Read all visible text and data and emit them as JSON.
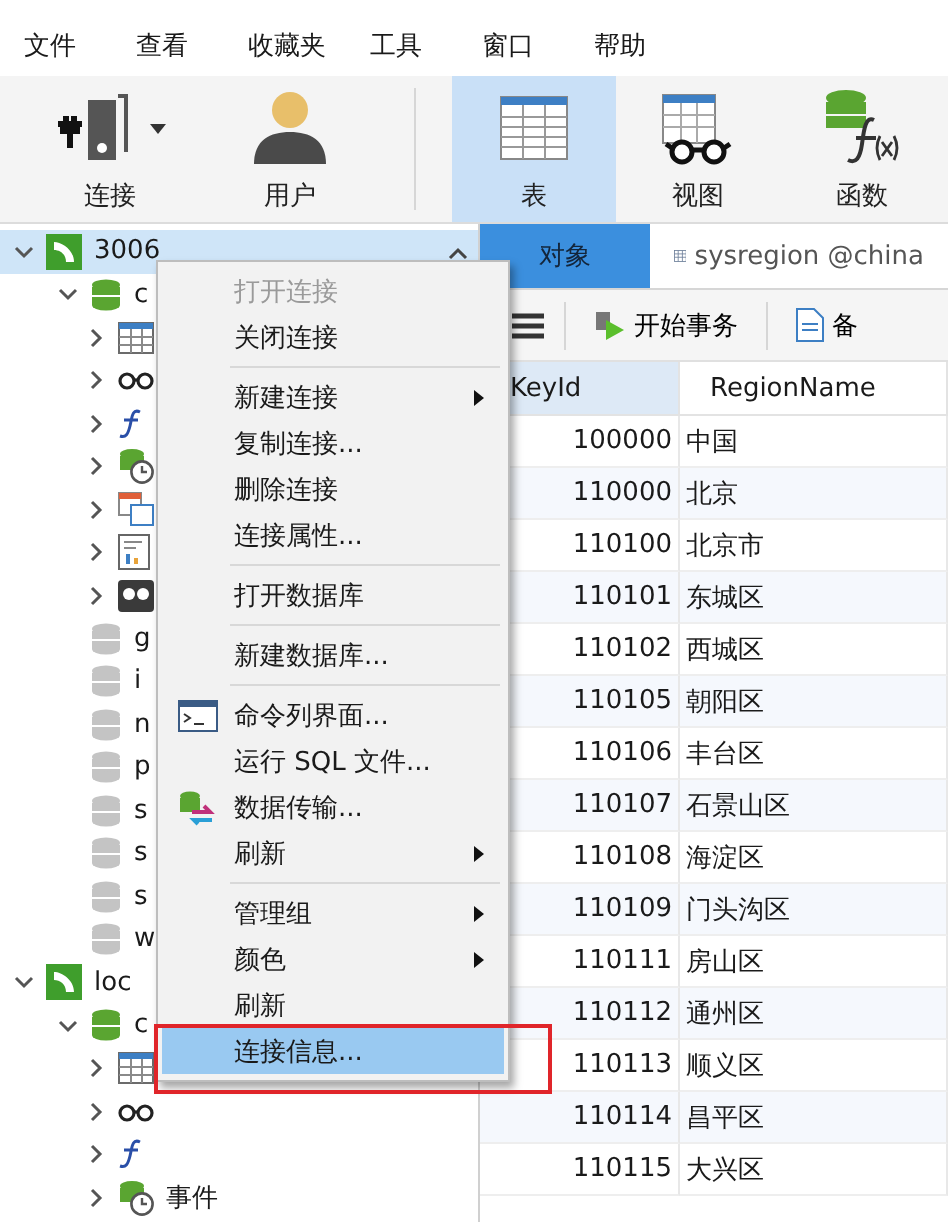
{
  "menu_bar": [
    "文件",
    "查看",
    "收藏夹",
    "工具",
    "窗口",
    "帮助"
  ],
  "toolbar": [
    {
      "label": "连接",
      "kind": "connection",
      "dropdown": true,
      "selected": false
    },
    {
      "label": "用户",
      "kind": "user",
      "dropdown": false,
      "selected": false
    },
    {
      "kind": "separator"
    },
    {
      "label": "表",
      "kind": "table",
      "dropdown": false,
      "selected": true
    },
    {
      "label": "视图",
      "kind": "view",
      "dropdown": false,
      "selected": false
    },
    {
      "label": "函数",
      "kind": "function",
      "dropdown": false,
      "selected": false
    }
  ],
  "tree": [
    {
      "label": "3006",
      "kind": "connection",
      "expanded": true,
      "selected": true,
      "children": [
        {
          "label": "c",
          "kind": "database",
          "open": true,
          "expanded": true,
          "selected": false,
          "children": [
            {
              "kind": "tables",
              "expanded": false,
              "selected": false
            },
            {
              "kind": "views",
              "expanded": false,
              "selected": false
            },
            {
              "kind": "functions",
              "expanded": false,
              "selected": false
            },
            {
              "kind": "events",
              "expanded": false,
              "selected": false
            },
            {
              "kind": "queries",
              "expanded": false,
              "selected": false
            },
            {
              "kind": "reports",
              "expanded": false,
              "selected": false
            },
            {
              "kind": "backups",
              "expanded": false,
              "selected": false
            }
          ]
        },
        {
          "label": "g",
          "kind": "database",
          "open": false,
          "selected": false
        },
        {
          "label": "i",
          "kind": "database",
          "open": false,
          "selected": false
        },
        {
          "label": "n",
          "kind": "database",
          "open": false,
          "selected": false
        },
        {
          "label": "p",
          "kind": "database",
          "open": false,
          "selected": false
        },
        {
          "label": "s",
          "kind": "database",
          "open": false,
          "selected": false
        },
        {
          "label": "s",
          "kind": "database",
          "open": false,
          "selected": false
        },
        {
          "label": "s",
          "kind": "database",
          "open": false,
          "selected": false
        },
        {
          "label": "w",
          "kind": "database",
          "open": false,
          "selected": false
        }
      ]
    },
    {
      "label": "loc",
      "kind": "connection",
      "expanded": true,
      "selected": false,
      "children": [
        {
          "label": "c",
          "kind": "database",
          "open": true,
          "expanded": true,
          "selected": false,
          "children": [
            {
              "kind": "tables",
              "expanded": false,
              "selected": false
            },
            {
              "kind": "views",
              "expanded": false,
              "selected": false
            },
            {
              "kind": "functions",
              "expanded": false,
              "selected": false
            },
            {
              "label": "事件",
              "kind": "events",
              "expanded": false,
              "selected": false
            }
          ]
        }
      ]
    }
  ],
  "tabs": [
    {
      "label": "对象",
      "kind": "objects",
      "selected": true
    },
    {
      "label": "sysregion @china",
      "kind": "table",
      "selected": false
    }
  ],
  "object_toolbar": [
    {
      "kind": "menu"
    },
    {
      "label": "开始事务",
      "kind": "transaction"
    },
    {
      "label": "备",
      "kind": "memo"
    }
  ],
  "table": {
    "columns": [
      {
        "label": "KeyId",
        "selected": true
      },
      {
        "label": "RegionName",
        "selected": false
      }
    ],
    "rows": [
      [
        "100000",
        "中国"
      ],
      [
        "110000",
        "北京"
      ],
      [
        "110100",
        "北京市"
      ],
      [
        "110101",
        "东城区"
      ],
      [
        "110102",
        "西城区"
      ],
      [
        "110105",
        "朝阳区"
      ],
      [
        "110106",
        "丰台区"
      ],
      [
        "110107",
        "石景山区"
      ],
      [
        "110108",
        "海淀区"
      ],
      [
        "110109",
        "门头沟区"
      ],
      [
        "110111",
        "房山区"
      ],
      [
        "110112",
        "通州区"
      ],
      [
        "110113",
        "顺义区"
      ],
      [
        "110114",
        "昌平区"
      ],
      [
        "110115",
        "大兴区"
      ]
    ]
  },
  "context_menu": {
    "items": [
      {
        "kind": "item",
        "label": "打开连接",
        "disabled": true,
        "submenu": false,
        "selected": false,
        "framed": false
      },
      {
        "kind": "item",
        "label": "关闭连接",
        "disabled": false,
        "submenu": false,
        "selected": false,
        "framed": false
      },
      {
        "kind": "separator"
      },
      {
        "kind": "item",
        "label": "新建连接",
        "disabled": false,
        "submenu": true,
        "selected": false,
        "framed": false
      },
      {
        "kind": "item",
        "label": "复制连接...",
        "disabled": false,
        "submenu": false,
        "selected": false,
        "framed": false
      },
      {
        "kind": "item",
        "label": "删除连接",
        "disabled": false,
        "submenu": false,
        "selected": false,
        "framed": false
      },
      {
        "kind": "item",
        "label": "连接属性...",
        "disabled": false,
        "submenu": false,
        "selected": false,
        "framed": false
      },
      {
        "kind": "separator"
      },
      {
        "kind": "item",
        "label": "打开数据库",
        "disabled": false,
        "submenu": false,
        "selected": false,
        "framed": false
      },
      {
        "kind": "separator"
      },
      {
        "kind": "item",
        "label": "新建数据库...",
        "disabled": false,
        "submenu": false,
        "selected": false,
        "framed": false
      },
      {
        "kind": "separator"
      },
      {
        "kind": "console",
        "label": "命令列界面...",
        "disabled": false,
        "submenu": false,
        "selected": false,
        "framed": false
      },
      {
        "kind": "item",
        "label": "运行 SQL 文件...",
        "disabled": false,
        "submenu": false,
        "selected": false,
        "framed": false
      },
      {
        "kind": "transfer",
        "label": "数据传输...",
        "disabled": false,
        "submenu": false,
        "selected": false,
        "framed": false
      },
      {
        "kind": "item",
        "label": "刷新",
        "disabled": false,
        "submenu": true,
        "selected": false,
        "framed": false
      },
      {
        "kind": "separator"
      },
      {
        "kind": "item",
        "label": "管理组",
        "disabled": false,
        "submenu": true,
        "selected": false,
        "framed": false
      },
      {
        "kind": "item",
        "label": "颜色",
        "disabled": false,
        "submenu": true,
        "selected": false,
        "framed": false
      },
      {
        "kind": "item",
        "label": "刷新",
        "disabled": false,
        "submenu": false,
        "selected": false,
        "framed": false
      },
      {
        "kind": "item",
        "label": "连接信息...",
        "disabled": false,
        "submenu": false,
        "selected": true,
        "framed": true
      }
    ]
  }
}
